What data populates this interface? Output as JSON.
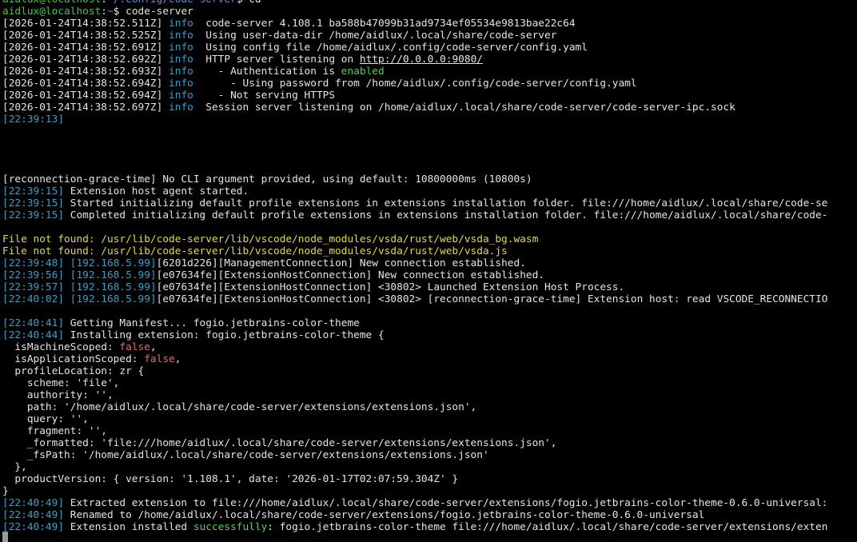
{
  "terminal": {
    "lines": [
      {
        "segs": [
          {
            "t": "aidlux@localhost",
            "c": "g"
          },
          {
            "t": ":"
          },
          {
            "t": "~/.config/code-server",
            "c": "b"
          },
          {
            "t": "$ cd"
          }
        ]
      },
      {
        "segs": [
          {
            "t": "aidlux@localhost",
            "c": "g"
          },
          {
            "t": ":"
          },
          {
            "t": "~",
            "c": "b"
          },
          {
            "t": "$ code-server"
          }
        ]
      },
      {
        "segs": [
          {
            "t": "[2026-01-24T14:38:52.511Z] "
          },
          {
            "t": "info",
            "c": "c"
          },
          {
            "t": "  code-server 4.108.1 ba588b47099b31ad9734ef05534e9813bae22c64"
          }
        ]
      },
      {
        "segs": [
          {
            "t": "[2026-01-24T14:38:52.525Z] "
          },
          {
            "t": "info",
            "c": "c"
          },
          {
            "t": "  Using user-data-dir /home/aidlux/.local/share/code-server"
          }
        ]
      },
      {
        "segs": [
          {
            "t": "[2026-01-24T14:38:52.691Z] "
          },
          {
            "t": "info",
            "c": "c"
          },
          {
            "t": "  Using config file /home/aidlux/.config/code-server/config.yaml"
          }
        ]
      },
      {
        "segs": [
          {
            "t": "[2026-01-24T14:38:52.692Z] "
          },
          {
            "t": "info",
            "c": "c"
          },
          {
            "t": "  HTTP server listening on "
          },
          {
            "t": "http://0.0.0.0:9080/",
            "c": "u"
          }
        ]
      },
      {
        "segs": [
          {
            "t": "[2026-01-24T14:38:52.693Z] "
          },
          {
            "t": "info",
            "c": "c"
          },
          {
            "t": "    - Authentication is "
          },
          {
            "t": "enabled",
            "c": "gs"
          }
        ]
      },
      {
        "segs": [
          {
            "t": "[2026-01-24T14:38:52.694Z] "
          },
          {
            "t": "info",
            "c": "c"
          },
          {
            "t": "      - Using password from /home/aidlux/.config/code-server/config.yaml"
          }
        ]
      },
      {
        "segs": [
          {
            "t": "[2026-01-24T14:38:52.694Z] "
          },
          {
            "t": "info",
            "c": "c"
          },
          {
            "t": "    - Not serving HTTPS"
          }
        ]
      },
      {
        "segs": [
          {
            "t": "[2026-01-24T14:38:52.697Z] "
          },
          {
            "t": "info",
            "c": "c"
          },
          {
            "t": "  Session server listening on /home/aidlux/.local/share/code-server/code-server-ipc.sock"
          }
        ]
      },
      {
        "segs": [
          {
            "t": "[22:39:13]",
            "c": "c"
          }
        ]
      },
      {
        "segs": []
      },
      {
        "segs": []
      },
      {
        "segs": []
      },
      {
        "segs": []
      },
      {
        "segs": [
          {
            "t": "[reconnection-grace-time] No CLI argument provided, using default: 10800000ms (10800s)"
          }
        ]
      },
      {
        "segs": [
          {
            "t": "[22:39:15]",
            "c": "c"
          },
          {
            "t": " Extension host agent started."
          }
        ]
      },
      {
        "segs": [
          {
            "t": "[22:39:15]",
            "c": "c"
          },
          {
            "t": " Started initializing default profile extensions in extensions installation folder. file:///home/aidlux/.local/share/code-se"
          }
        ]
      },
      {
        "segs": [
          {
            "t": "[22:39:15]",
            "c": "c"
          },
          {
            "t": " Completed initializing default profile extensions in extensions installation folder. file:///home/aidlux/.local/share/code-"
          }
        ]
      },
      {
        "segs": []
      },
      {
        "segs": [
          {
            "t": "File not found: /usr/lib/code-server/lib/vscode/node_modules/vsda/rust/web/vsda_bg.wasm",
            "c": "y"
          }
        ]
      },
      {
        "segs": [
          {
            "t": "File not found: /usr/lib/code-server/lib/vscode/node_modules/vsda/rust/web/vsda.js",
            "c": "y"
          }
        ]
      },
      {
        "segs": [
          {
            "t": "[22:39:48]",
            "c": "c"
          },
          {
            "t": " "
          },
          {
            "t": "[192.168.5.99]",
            "c": "c"
          },
          {
            "t": "[6201d226][ManagementConnection] New connection established."
          }
        ]
      },
      {
        "segs": [
          {
            "t": "[22:39:56]",
            "c": "c"
          },
          {
            "t": " "
          },
          {
            "t": "[192.168.5.99]",
            "c": "c"
          },
          {
            "t": "[e07634fe][ExtensionHostConnection] New connection established."
          }
        ]
      },
      {
        "segs": [
          {
            "t": "[22:39:57]",
            "c": "c"
          },
          {
            "t": " "
          },
          {
            "t": "[192.168.5.99]",
            "c": "c"
          },
          {
            "t": "[e07634fe][ExtensionHostConnection] <30802> Launched Extension Host Process."
          }
        ]
      },
      {
        "segs": [
          {
            "t": "[22:40:02]",
            "c": "c"
          },
          {
            "t": " "
          },
          {
            "t": "[192.168.5.99]",
            "c": "c"
          },
          {
            "t": "[e07634fe][ExtensionHostConnection] <30802> [reconnection-grace-time] Extension host: read VSCODE_RECONNECTIO"
          }
        ]
      },
      {
        "segs": []
      },
      {
        "segs": [
          {
            "t": "[22:40:41]",
            "c": "c"
          },
          {
            "t": " Getting Manifest... fogio.jetbrains-color-theme"
          }
        ]
      },
      {
        "segs": [
          {
            "t": "[22:40:44]",
            "c": "c"
          },
          {
            "t": " Installing extension: fogio.jetbrains-color-theme {"
          }
        ]
      },
      {
        "segs": [
          {
            "t": "  isMachineScoped: "
          },
          {
            "t": "false",
            "c": "r"
          },
          {
            "t": ","
          }
        ]
      },
      {
        "segs": [
          {
            "t": "  isApplicationScoped: "
          },
          {
            "t": "false",
            "c": "r"
          },
          {
            "t": ","
          }
        ]
      },
      {
        "segs": [
          {
            "t": "  profileLocation: zr {"
          }
        ]
      },
      {
        "segs": [
          {
            "t": "    scheme: 'file',"
          }
        ]
      },
      {
        "segs": [
          {
            "t": "    authority: '',"
          }
        ]
      },
      {
        "segs": [
          {
            "t": "    path: '/home/aidlux/.local/share/code-server/extensions/extensions.json',"
          }
        ]
      },
      {
        "segs": [
          {
            "t": "    query: '',"
          }
        ]
      },
      {
        "segs": [
          {
            "t": "    fragment: '',"
          }
        ]
      },
      {
        "segs": [
          {
            "t": "    _formatted: 'file:///home/aidlux/.local/share/code-server/extensions/extensions.json',"
          }
        ]
      },
      {
        "segs": [
          {
            "t": "    _fsPath: '/home/aidlux/.local/share/code-server/extensions/extensions.json'"
          }
        ]
      },
      {
        "segs": [
          {
            "t": "  },"
          }
        ]
      },
      {
        "segs": [
          {
            "t": "  productVersion: { version: '1.108.1', date: '2026-01-17T02:07:59.304Z' }"
          }
        ]
      },
      {
        "segs": [
          {
            "t": "}"
          }
        ]
      },
      {
        "segs": [
          {
            "t": "[22:40:49]",
            "c": "c"
          },
          {
            "t": " Extracted extension to file:///home/aidlux/.local/share/code-server/extensions/fogio.jetbrains-color-theme-0.6.0-universal:"
          }
        ]
      },
      {
        "segs": [
          {
            "t": "[22:40:49]",
            "c": "c"
          },
          {
            "t": " Renamed to /home/aidlux/.local/share/code-server/extensions/fogio.jetbrains-color-theme-0.6.0-universal"
          }
        ]
      },
      {
        "segs": [
          {
            "t": "[22:40:49]",
            "c": "c"
          },
          {
            "t": " Extension installed "
          },
          {
            "t": "successfully",
            "c": "gs"
          },
          {
            "t": ": fogio.jetbrains-color-theme file:///home/aidlux/.local/share/code-server/extensions/exten"
          }
        ]
      }
    ]
  }
}
